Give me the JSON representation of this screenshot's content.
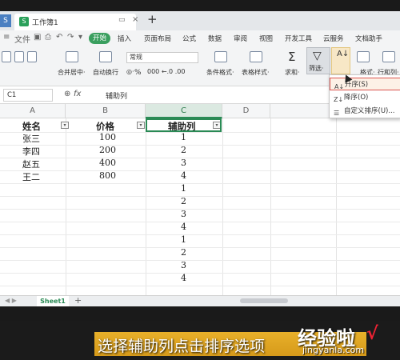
{
  "titlebar": {
    "app_tab": "S",
    "doc_name": "工作簿1",
    "new_tab": "+"
  },
  "menubar": {
    "start": "开始",
    "items": [
      "插入",
      "页面布局",
      "公式",
      "数据",
      "审阅",
      "视图",
      "开发工具",
      "云服务",
      "文档助手"
    ]
  },
  "ribbon": {
    "font_name": "常规",
    "merge_center": "合并居中·",
    "wrap_text": "自动换行",
    "percent": "%",
    "conditional_format": "条件格式·",
    "table_style": "表格样式·",
    "sum": "求和·",
    "filter": "筛选·",
    "format": "格式·",
    "row_col": "行和列·"
  },
  "formula": {
    "namebox": "C1",
    "fx": "fx",
    "value": "辅助列"
  },
  "columns": [
    "A",
    "B",
    "C",
    "D",
    "E"
  ],
  "table": {
    "headers": [
      "姓名",
      "价格",
      "辅助列"
    ],
    "names": [
      "张三",
      "李四",
      "赵五",
      "王二"
    ],
    "prices": [
      "100",
      "200",
      "400",
      "800"
    ],
    "helper": [
      "1",
      "2",
      "3",
      "4",
      "1",
      "2",
      "3",
      "4",
      "1",
      "2",
      "3",
      "4"
    ]
  },
  "sort_menu": {
    "items": [
      "升序(S)",
      "降序(O)",
      "自定义排序(U)..."
    ]
  },
  "sheetbar": {
    "sheet1": "Sheet1",
    "add": "+"
  },
  "caption": {
    "text": "选择辅助列点击排序选项",
    "watermark": "经验啦",
    "watermark_sub": "jingyanla.com",
    "check": "√"
  }
}
